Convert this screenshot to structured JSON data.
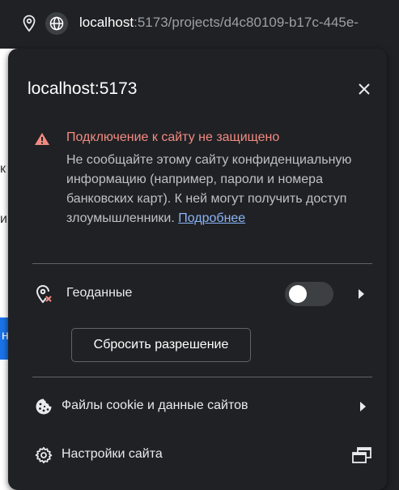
{
  "address_bar": {
    "url_host": "localhost",
    "url_rest": ":5173/projects/d4c80109-b17c-445e-"
  },
  "popup": {
    "title": "localhost:5173",
    "warning": {
      "title": "Подключение к сайту не защищено",
      "body": "Не сообщайте этому сайту конфиденциальную информацию (например, пароли и номера банковских карт). К ней могут получить доступ злоумышленники. ",
      "link": "Подробнее"
    },
    "permission": {
      "label": "Геоданные",
      "enabled": false,
      "reset_label": "Сбросить разрешение"
    },
    "cookies_label": "Файлы cookie и данные сайтов",
    "settings_label": "Настройки сайта"
  },
  "background": {
    "fragments": [
      "к",
      "и",
      "н"
    ]
  },
  "colors": {
    "popup_bg": "#202124",
    "warning_text": "#f28b82",
    "link": "#8ab4f8",
    "toolbar_bg": "#202124"
  }
}
